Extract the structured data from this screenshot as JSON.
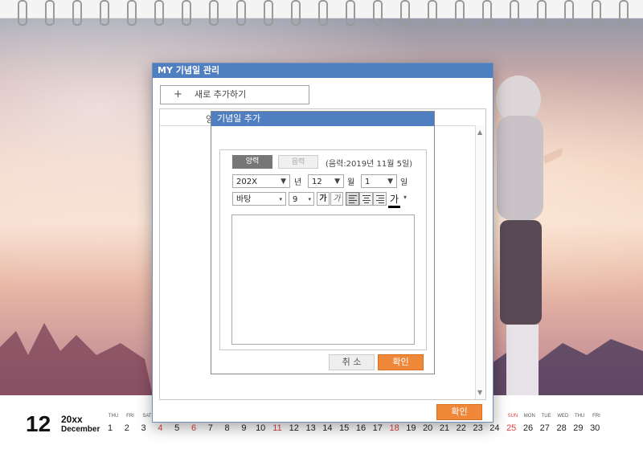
{
  "calendar": {
    "month_number": "12",
    "year": "20xx",
    "month_name": "December",
    "days_left": [
      "THU",
      "FRI",
      "SAT"
    ],
    "days_right": [
      "SUN",
      "MON",
      "TUE",
      "WED",
      "THU",
      "FRI"
    ],
    "dates": [
      "1",
      "2",
      "3",
      "4",
      "5",
      "6",
      "7",
      "8",
      "9",
      "10",
      "11",
      "12",
      "13",
      "14",
      "15",
      "16",
      "17",
      "18",
      "19",
      "20",
      "21",
      "22",
      "23",
      "24",
      "25",
      "26",
      "27",
      "28",
      "29",
      "30"
    ],
    "holiday_dates": [
      "4",
      "6",
      "11",
      "18",
      "25"
    ],
    "accent_red": "#e04040"
  },
  "manager_dialog": {
    "title": "MY 기념일 관리",
    "add_new_label": "새로 추가하기",
    "list_header": "양",
    "ok_label": "확인",
    "title_color": "#4f7fc0",
    "ok_color": "#f0883a"
  },
  "add_dialog": {
    "title": "기념일 추가",
    "solar_label": "양력",
    "lunar_label": "음력",
    "lunar_info": "(음력:2019년 11월 5일)",
    "year_value": "202X",
    "year_unit": "년",
    "month_value": "12",
    "month_unit": "월",
    "day_value": "1",
    "day_unit": "일",
    "font_value": "바탕",
    "font_size_value": "9",
    "bold_label": "가",
    "italic_label": "가",
    "text_color_label": "가",
    "cancel_label": "취 소",
    "ok_label": "확인"
  },
  "icons": [
    "plus-icon",
    "dropdown-arrow-icon",
    "align-left-icon",
    "align-center-icon",
    "align-right-icon",
    "text-color-icon",
    "scroll-up-icon",
    "scroll-down-icon"
  ]
}
